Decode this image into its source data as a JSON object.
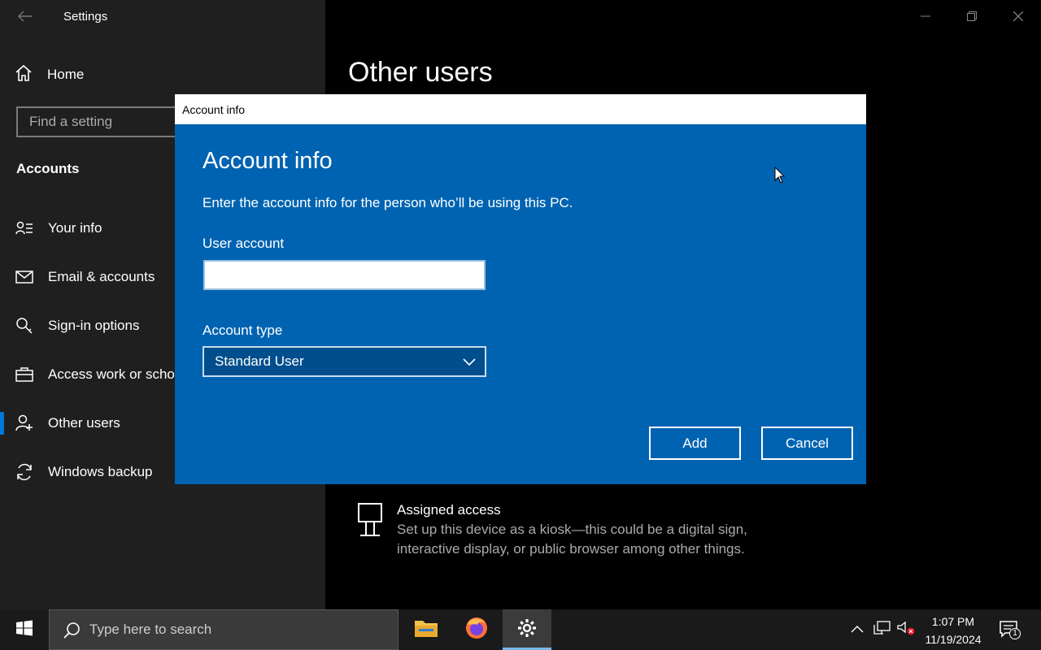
{
  "window": {
    "title": "Settings",
    "page_title": "Other users"
  },
  "sidebar": {
    "home_label": "Home",
    "search_placeholder": "Find a setting",
    "section_title": "Accounts",
    "items": [
      {
        "label": "Your info",
        "icon": "person-list-icon"
      },
      {
        "label": "Email & accounts",
        "icon": "mail-icon"
      },
      {
        "label": "Sign-in options",
        "icon": "key-icon"
      },
      {
        "label": "Access work or school",
        "icon": "briefcase-icon"
      },
      {
        "label": "Other users",
        "icon": "person-add-icon",
        "active": true
      },
      {
        "label": "Windows backup",
        "icon": "sync-icon"
      }
    ]
  },
  "assigned_access": {
    "title": "Assigned access",
    "description": "Set up this device as a kiosk—this could be a digital sign, interactive display, or public browser among other things."
  },
  "dialog": {
    "window_title": "Account info",
    "heading": "Account info",
    "description": "Enter the account info for the person who’ll be using this PC.",
    "user_account_label": "User account",
    "user_account_value": "",
    "account_type_label": "Account type",
    "account_type_value": "Standard User",
    "add_label": "Add",
    "cancel_label": "Cancel"
  },
  "taskbar": {
    "search_placeholder": "Type here to search",
    "time": "1:07 PM",
    "date": "11/19/2024",
    "notification_count": "1"
  },
  "colors": {
    "accent": "#0078d7",
    "dialog_bg": "#0063b1",
    "sidebar_bg": "#1f1f1f"
  }
}
